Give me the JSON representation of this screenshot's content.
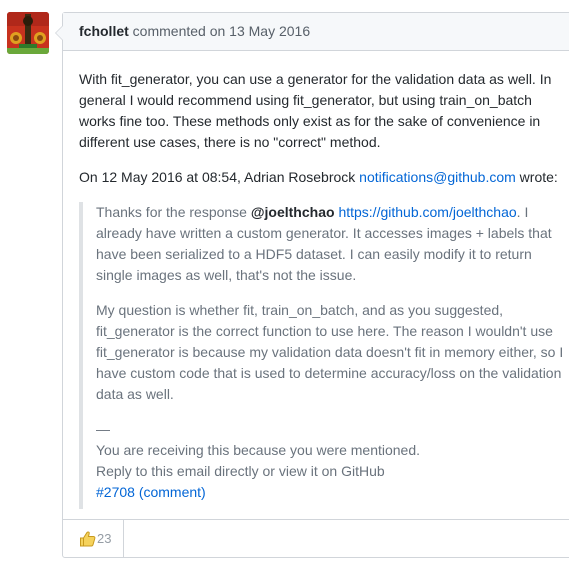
{
  "comment": {
    "author": "fchollet",
    "action": "commented on",
    "date": "13 May 2016",
    "paragraph1": "With fit_generator, you can use a generator for the validation data as well. In general I would recommend using fit_generator, but using train_on_batch works fine too. These methods only exist as for the sake of convenience in different use cases, there is no \"correct\" method.",
    "reply_intro": "On 12 May 2016 at 08:54, Adrian Rosebrock ",
    "reply_email": "notifications@github.com",
    "reply_suffix": " wrote:",
    "quote": {
      "p1_prefix": "Thanks for the response ",
      "p1_mention": "@joelthchao",
      "p1_space": " ",
      "p1_link": "https://github.com/joelthchao",
      "p1_rest": ". I already have written a custom generator. It accesses images + labels that have been serialized to a HDF5 dataset. I can easily modify it to return single images as well, that's not the issue.",
      "p2": "My question is whether fit, train_on_batch, and as you suggested, fit_generator is the correct function to use here. The reason I wouldn't use fit_generator is because my validation data doesn't fit in memory either, so I have custom code that is used to determine accuracy/loss on the validation data as well.",
      "sep": "—",
      "footer1": "You are receiving this because you were mentioned.",
      "footer2": "Reply to this email directly or view it on GitHub",
      "footer3": "#2708 (comment)"
    }
  },
  "reactions": {
    "thumbs_up_count": "23"
  },
  "colors": {
    "link": "#0366d6",
    "muted": "#6a737d",
    "border": "#d1d5da",
    "header_bg": "#f6f8fa"
  }
}
